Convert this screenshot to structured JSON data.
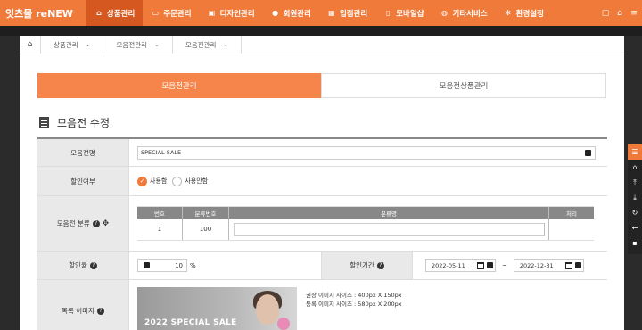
{
  "logo": "잇츠몰 reNEW",
  "nav": [
    {
      "label": "상품관리",
      "icon": "house-icon",
      "glyph": "⌂",
      "active": true
    },
    {
      "label": "주문관리",
      "icon": "card-icon",
      "glyph": "▭",
      "active": false
    },
    {
      "label": "디자인관리",
      "icon": "monitor-icon",
      "glyph": "▣",
      "active": false
    },
    {
      "label": "회원관리",
      "icon": "users-icon",
      "glyph": "●",
      "active": false
    },
    {
      "label": "입점관리",
      "icon": "building-icon",
      "glyph": "▦",
      "active": false
    },
    {
      "label": "모바일샵",
      "icon": "mobile-icon",
      "glyph": "▯",
      "active": false
    },
    {
      "label": "기타서비스",
      "icon": "chat-icon",
      "glyph": "◍",
      "active": false
    },
    {
      "label": "환경설정",
      "icon": "gear-icon",
      "glyph": "✻",
      "active": false
    }
  ],
  "breadcrumb": [
    "상품관리",
    "모음전관리",
    "모음전관리"
  ],
  "tabs": {
    "active": "모음전관리",
    "inactive": "모음전상품관리"
  },
  "section_title": "모음전 수정",
  "form": {
    "name_label": "모음전명",
    "name_value": "SPECIAL SALE",
    "discount_use_label": "할인여부",
    "radio_use": "사용함",
    "radio_unuse": "사용안함",
    "category_label": "모음전 분류",
    "cat_headers": [
      "번호",
      "분류번호",
      "분류명",
      "처리"
    ],
    "cat_row": {
      "no": "1",
      "code": "100"
    },
    "rate_label": "할인율",
    "rate_value": "10",
    "rate_unit": "%",
    "period_label": "할인기간",
    "start_date": "2022-05-11",
    "tilde": "~",
    "end_date": "2022-12-31",
    "image_label": "목록 이미지",
    "promo_text": "2022 SPECIAL SALE",
    "note1": "권장 이미지 사이즈 : 400px X 150px",
    "note2": "등록 이미지 사이즈 : 580px X 200px"
  }
}
